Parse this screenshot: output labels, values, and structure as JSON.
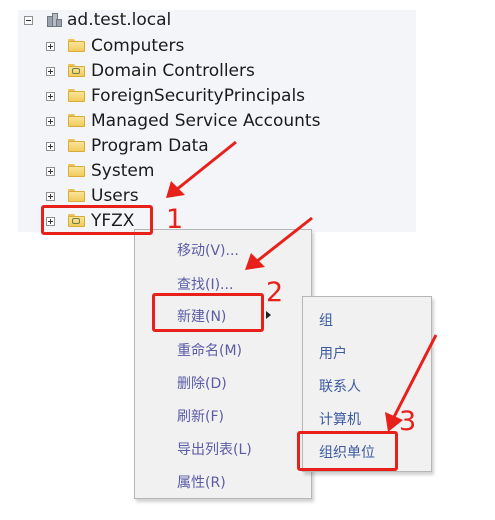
{
  "tree": {
    "root": {
      "label": "ad.test.local",
      "icon": "domain-icon"
    },
    "items": [
      {
        "label": "Computers",
        "icon": "folder-icon"
      },
      {
        "label": "Domain Controllers",
        "icon": "ou-folder-icon"
      },
      {
        "label": "ForeignSecurityPrincipals",
        "icon": "folder-icon"
      },
      {
        "label": "Managed Service Accounts",
        "icon": "folder-icon"
      },
      {
        "label": "Program Data",
        "icon": "folder-icon"
      },
      {
        "label": "System",
        "icon": "folder-icon"
      },
      {
        "label": "Users",
        "icon": "folder-icon"
      },
      {
        "label": "YFZX",
        "icon": "ou-folder-icon"
      }
    ]
  },
  "context_menu": {
    "items": [
      "移动(V)...",
      "查找(I)...",
      "新建(N)",
      "重命名(M)",
      "删除(D)",
      "刷新(F)",
      "导出列表(L)",
      "属性(R)"
    ]
  },
  "submenu": {
    "items": [
      "组",
      "用户",
      "联系人",
      "计算机",
      "组织单位"
    ]
  },
  "annotations": {
    "step1": "1",
    "step2": "2",
    "step3": "3",
    "color": "#e8201a"
  }
}
